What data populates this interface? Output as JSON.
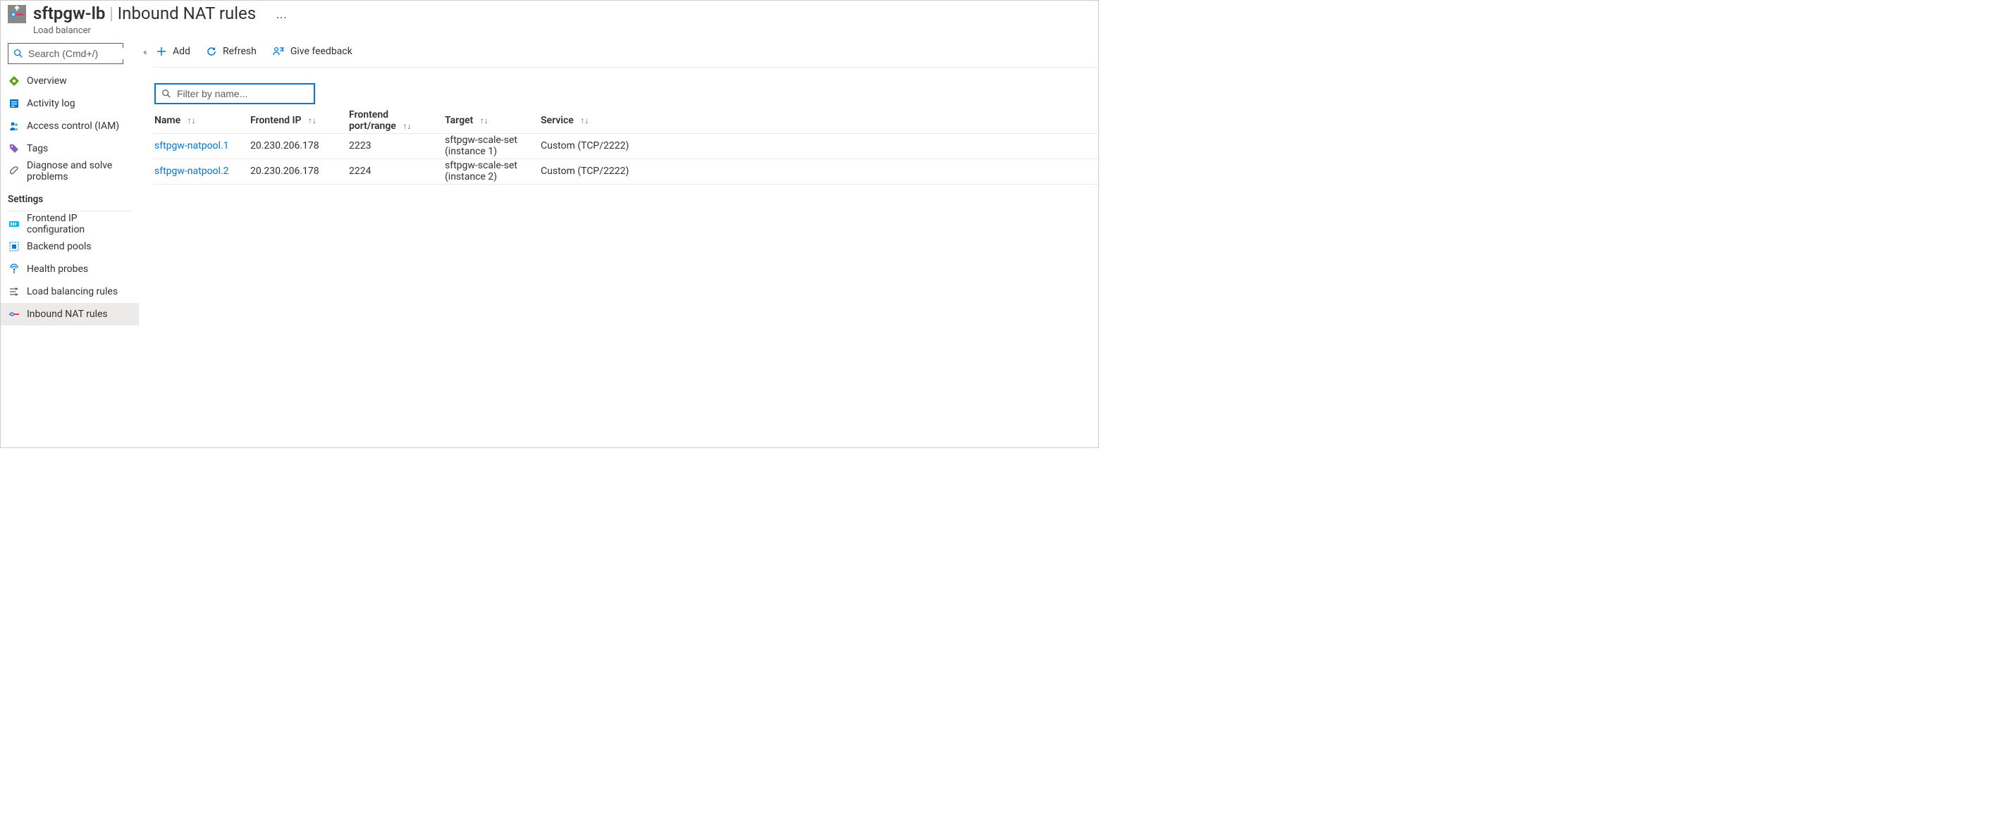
{
  "header": {
    "resource_name": "sftpgw-lb",
    "section_title": "Inbound NAT rules",
    "subtitle": "Load balancer"
  },
  "sidebar": {
    "search_placeholder": "Search (Cmd+/)",
    "items_top": [
      {
        "id": "overview",
        "label": "Overview"
      },
      {
        "id": "activity-log",
        "label": "Activity log"
      },
      {
        "id": "access-control",
        "label": "Access control (IAM)"
      },
      {
        "id": "tags",
        "label": "Tags"
      },
      {
        "id": "diagnose",
        "label": "Diagnose and solve problems"
      }
    ],
    "group_settings": "Settings",
    "items_settings": [
      {
        "id": "frontend-ip",
        "label": "Frontend IP configuration"
      },
      {
        "id": "backend-pools",
        "label": "Backend pools"
      },
      {
        "id": "health-probes",
        "label": "Health probes"
      },
      {
        "id": "lb-rules",
        "label": "Load balancing rules"
      },
      {
        "id": "inbound-nat",
        "label": "Inbound NAT rules",
        "selected": true
      }
    ]
  },
  "toolbar": {
    "add": "Add",
    "refresh": "Refresh",
    "feedback": "Give feedback"
  },
  "filter": {
    "placeholder": "Filter by name..."
  },
  "table": {
    "columns": {
      "name": "Name",
      "frontend_ip": "Frontend IP",
      "frontend_port": "Frontend port/range",
      "target": "Target",
      "service": "Service"
    },
    "rows": [
      {
        "name": "sftpgw-natpool.1",
        "frontend_ip": "20.230.206.178",
        "frontend_port": "2223",
        "target": "sftpgw-scale-set (instance 1)",
        "service": "Custom (TCP/2222)"
      },
      {
        "name": "sftpgw-natpool.2",
        "frontend_ip": "20.230.206.178",
        "frontend_port": "2224",
        "target": "sftpgw-scale-set (instance 2)",
        "service": "Custom (TCP/2222)"
      }
    ]
  }
}
